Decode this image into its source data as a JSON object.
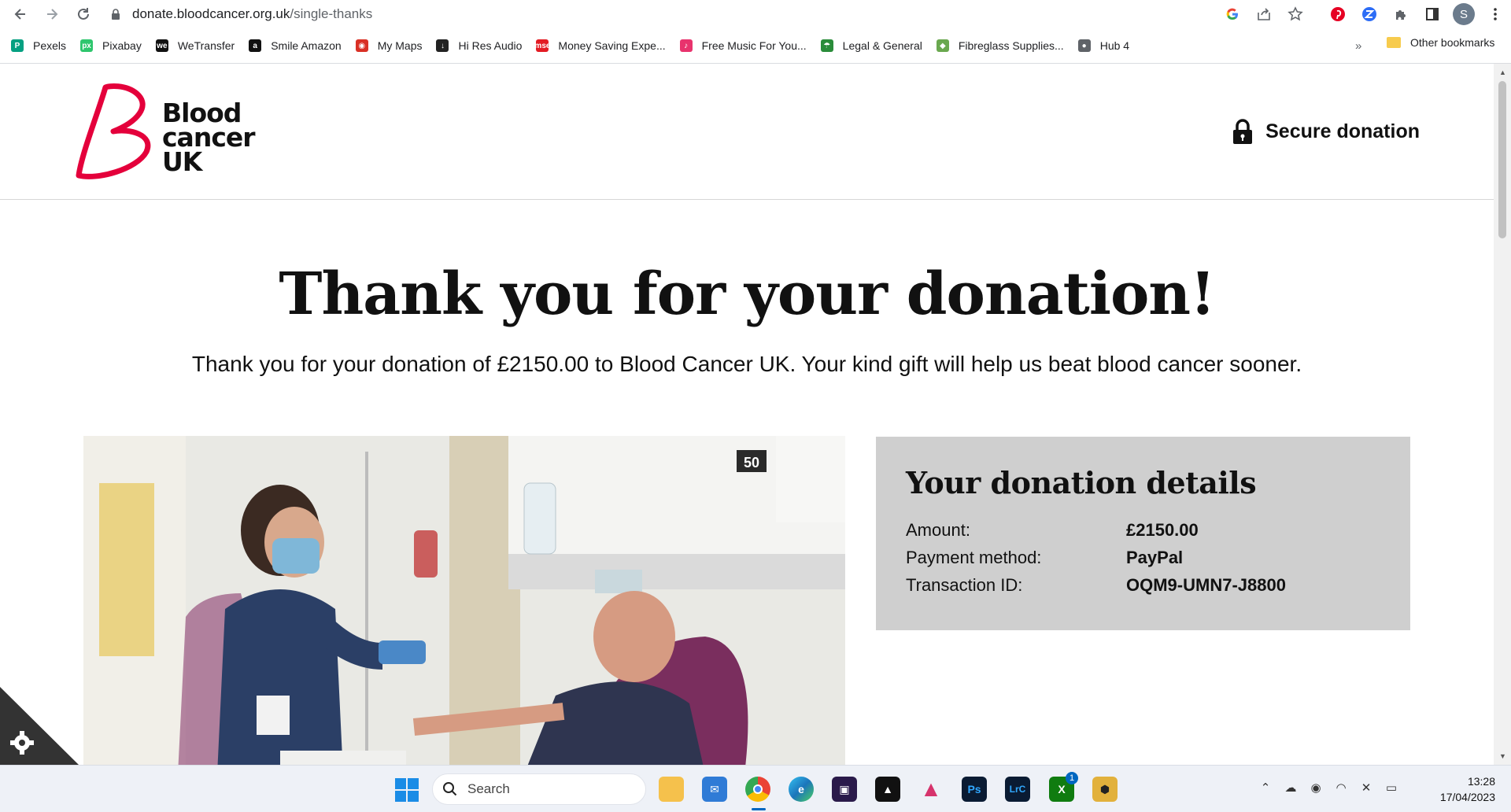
{
  "browser": {
    "url_host": "donate.bloodcancer.org.uk",
    "url_path": "/single-thanks",
    "profile_initial": "S",
    "bookmarks": [
      {
        "label": "Pexels",
        "color": "#05a081",
        "glyph": "P"
      },
      {
        "label": "Pixabay",
        "color": "#2ec66d",
        "glyph": "px"
      },
      {
        "label": "WeTransfer",
        "color": "#111111",
        "glyph": "we"
      },
      {
        "label": "Smile Amazon",
        "color": "#111111",
        "glyph": "a"
      },
      {
        "label": "My Maps",
        "color": "#d93025",
        "glyph": "◉"
      },
      {
        "label": "Hi Res Audio",
        "color": "#222222",
        "glyph": "↓"
      },
      {
        "label": "Money Saving Expe...",
        "color": "#e31b23",
        "glyph": "mse"
      },
      {
        "label": "Free Music For You...",
        "color": "#e8336d",
        "glyph": "♪"
      },
      {
        "label": "Legal & General",
        "color": "#2a8c3a",
        "glyph": "☂"
      },
      {
        "label": "Fibreglass Supplies...",
        "color": "#6aa84f",
        "glyph": "◆"
      },
      {
        "label": "Hub 4",
        "color": "#5f6368",
        "glyph": "●"
      }
    ],
    "more_label": "»",
    "other_bookmarks": "Other bookmarks"
  },
  "header": {
    "logo_text_line1": "Blood",
    "logo_text_line2": "cancer",
    "logo_text_line3": "UK",
    "secure_label": "Secure donation"
  },
  "main": {
    "headline": "Thank you for your donation!",
    "subline": "Thank you for your donation of £2150.00 to Blood Cancer UK. Your kind gift will help us beat blood cancer sooner."
  },
  "details": {
    "title": "Your donation details",
    "rows": [
      {
        "label": "Amount:",
        "value": "£2150.00"
      },
      {
        "label": "Payment method:",
        "value": "PayPal"
      },
      {
        "label": "Transaction ID:",
        "value": "OQM9-UMN7-J8800"
      }
    ]
  },
  "photo": {
    "sign_number": "50"
  },
  "taskbar": {
    "search_label": "Search",
    "time": "13:28",
    "date": "17/04/2023",
    "badge_count": "1",
    "apps": [
      "file-explorer",
      "mail",
      "chrome",
      "edge",
      "premiere-elements",
      "affinity-designer",
      "affinity-photo",
      "photoshop",
      "lightroom-classic",
      "xbox",
      "security"
    ]
  },
  "colors": {
    "brand_red": "#e4003b",
    "details_bg": "#cfcfcf"
  }
}
